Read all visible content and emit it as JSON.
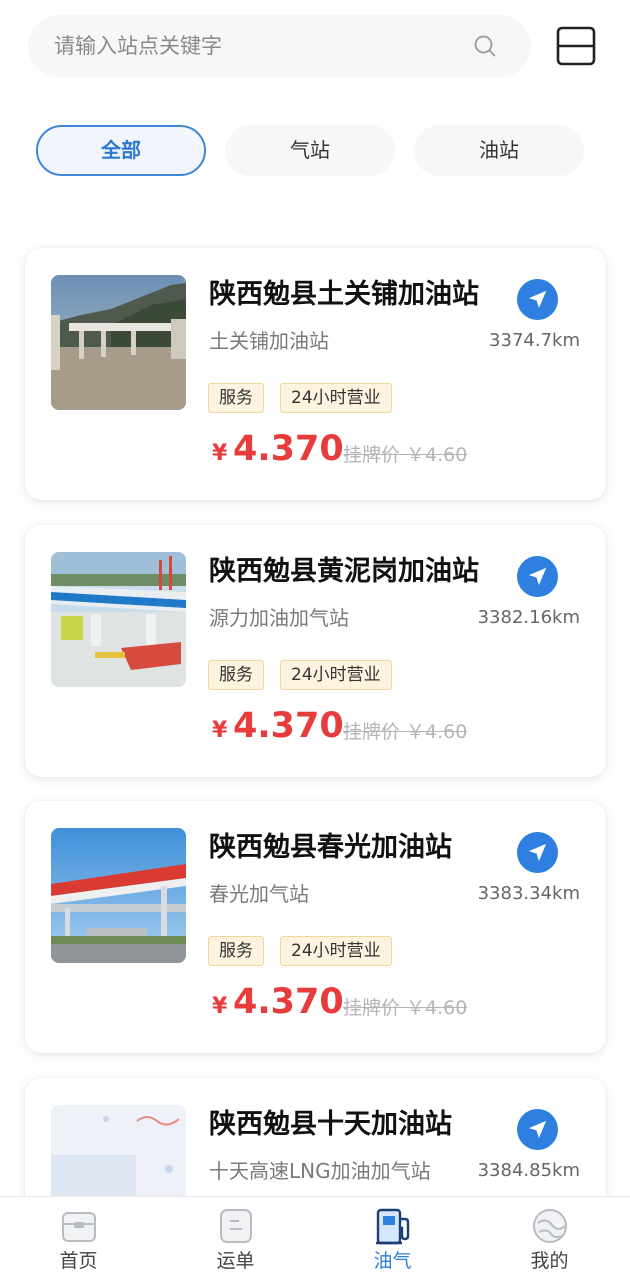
{
  "search": {
    "placeholder": "请输入站点关键字"
  },
  "tabs": [
    {
      "label": "全部",
      "active": true
    },
    {
      "label": "气站",
      "active": false
    },
    {
      "label": "油站",
      "active": false
    }
  ],
  "currency_symbol": "¥",
  "stations": [
    {
      "name": "陕西勉县土关铺加油站",
      "subtitle": "土关铺加油站",
      "distance": "3374.7km",
      "tags": [
        "服务",
        "24小时营业"
      ],
      "price": "4.370",
      "listed_price": "挂牌价 ￥4.60"
    },
    {
      "name": "陕西勉县黄泥岗加油站",
      "subtitle": "源力加油加气站",
      "distance": "3382.16km",
      "tags": [
        "服务",
        "24小时营业"
      ],
      "price": "4.370",
      "listed_price": "挂牌价 ￥4.60"
    },
    {
      "name": "陕西勉县春光加油站",
      "subtitle": "春光加气站",
      "distance": "3383.34km",
      "tags": [
        "服务",
        "24小时营业"
      ],
      "price": "4.370",
      "listed_price": "挂牌价 ￥4.60"
    },
    {
      "name": "陕西勉县十天加油站",
      "subtitle": "十天高速LNG加油加气站",
      "distance": "3384.85km"
    }
  ],
  "bottom_nav": [
    {
      "label": "首页",
      "icon": "home-box-icon",
      "active": false
    },
    {
      "label": "运单",
      "icon": "waybill-icon",
      "active": false
    },
    {
      "label": "油气",
      "icon": "fuel-pump-icon",
      "active": true
    },
    {
      "label": "我的",
      "icon": "profile-icon",
      "active": false
    }
  ],
  "colors": {
    "accent": "#2f7fe0",
    "price": "#e83b3b",
    "tag_bg": "#fdf3df"
  }
}
